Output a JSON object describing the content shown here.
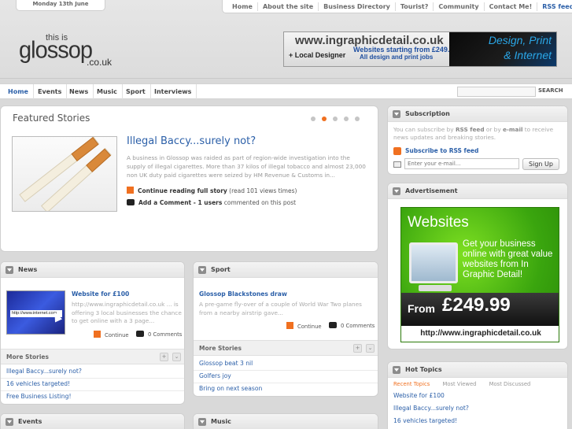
{
  "header": {
    "date": "Monday 13th June",
    "top_nav": [
      "Home",
      "About the site",
      "Business Directory",
      "Tourist?",
      "Community",
      "Contact Me!",
      "RSS feed"
    ],
    "logo": {
      "line1": "this is",
      "line2": "glossop",
      "line3": ".co.uk"
    },
    "banner": {
      "url": "www.ingraphicdetail.co.uk",
      "local_designer": "+ Local Designer",
      "websites_from": "Websites starting from £249.99",
      "all_design": "All design and print jobs",
      "design_print": "Design, Print",
      "internet": "& Internet"
    }
  },
  "main_nav": {
    "items": [
      "Home",
      "Events",
      "News",
      "Music",
      "Sport",
      "Interviews"
    ],
    "search_label": "SEARCH"
  },
  "featured": {
    "title": "Featured Stories",
    "slide_count": 5,
    "active_slide": 2,
    "headline": "Illegal Baccy...surely not?",
    "body": "A business in Glossop was raided as part of region-wide investigation into the supply of illegal cigarettes. More than 37 kilos of illegal tobacco and almost 23,000 non UK duty paid cigarettes were seized by HM Revenue & Customs in...",
    "continue_label": "Continue reading full story",
    "views": "(read 101 views times)",
    "comment_label": "Add a Comment - 1 users",
    "comment_suffix": "commented on this post"
  },
  "subscription": {
    "title": "Subscription",
    "text_a": "You can subscribe by ",
    "text_rss": "RSS feed",
    "text_b": " or by ",
    "text_email": "e-mail",
    "text_c": " to receive news updates and breaking stories.",
    "rss_link": "Subscribe to RSS feed",
    "email_placeholder": "Enter your e-mail...",
    "signup_label": "Sign Up"
  },
  "advertisement": {
    "title": "Advertisement",
    "ad_title": "Websites",
    "ad_copy": "Get your business online with great value websites from In Graphic Detail!",
    "ad_from": "From",
    "ad_price": "£249.99",
    "ad_url": "http://www.ingraphicdetail.co.uk"
  },
  "hot_topics": {
    "title": "Hot Topics",
    "tabs": [
      "Recent Topics",
      "Most Viewed",
      "Most Discussed"
    ],
    "items": [
      "Website for £100",
      "Illegal Baccy...surely not?",
      "16 vehicles targeted!"
    ]
  },
  "news": {
    "title": "News",
    "story_title": "Website for £100",
    "story_body": "http://www.ingraphicdetail.co.uk ... is offering 3 local businesses the chance to get online with a 3 page...",
    "image_text": "http://www.internet.com",
    "continue_label": "Continue",
    "comments_label": "0 Comments",
    "more_title": "More Stories",
    "more_items": [
      "Illegal Baccy...surely not?",
      "16 vehicles targeted!",
      "Free Business Listing!"
    ]
  },
  "sport": {
    "title": "Sport",
    "story_title": "Glossop Blackstones draw",
    "story_body": "A pre-game fly-over of a couple of World War Two planes from a nearby airstrip gave...",
    "continue_label": "Continue",
    "comments_label": "0 Comments",
    "more_title": "More Stories",
    "more_items": [
      "Glossop beat 3 nil",
      "Golfers joy",
      "Bring on next season"
    ]
  },
  "events": {
    "title": "Events"
  },
  "music": {
    "title": "Music"
  },
  "colors": {
    "accent": "#f07020",
    "link": "#2b5fa8"
  }
}
